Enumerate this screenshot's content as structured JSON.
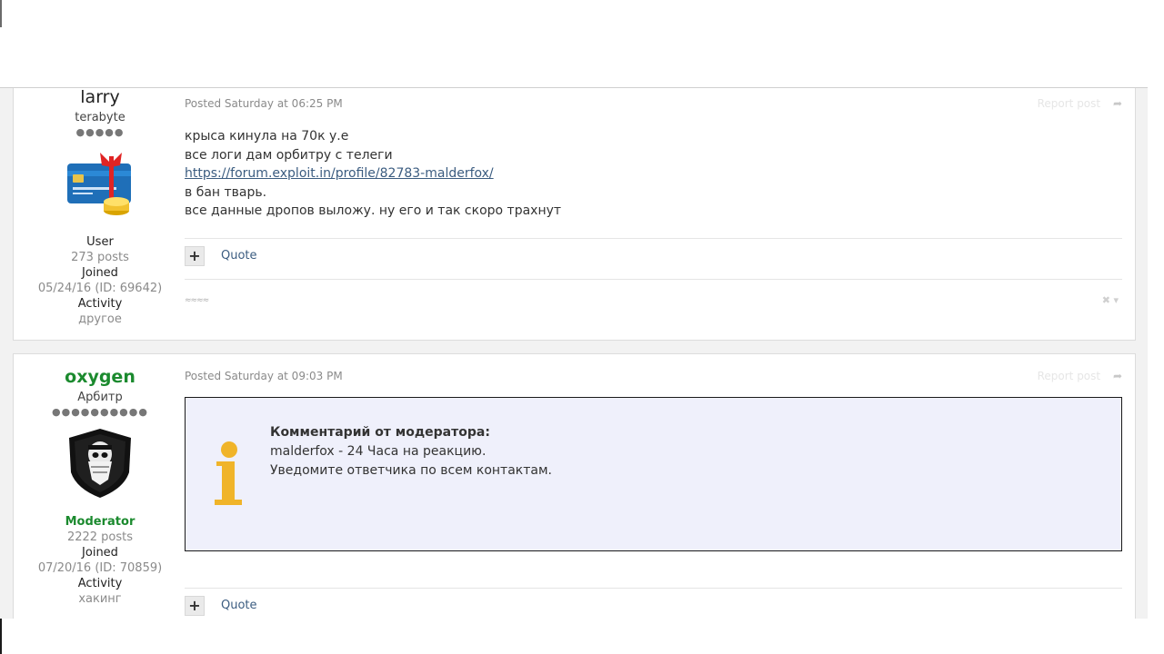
{
  "posts": [
    {
      "author": {
        "name": "larry",
        "title": "terabyte",
        "pips": "●●●●●",
        "role": "User",
        "posts": "273 posts",
        "joined_label": "Joined",
        "joined": "05/24/16 (ID: 69642)",
        "activity_label": "Activity",
        "activity": "другое"
      },
      "posted": "Posted Saturday at 06:25 PM",
      "report": "Report post",
      "lines": [
        "крыса кинула на 70к у.е",
        "все логи дам орбитру с телеги",
        "https://forum.exploit.in/profile/82783-malderfox/",
        "в бан тварь.",
        "все данные дропов выложу. ну его и так скоро трахнут"
      ],
      "actions": {
        "plus": "+",
        "quote": "Quote"
      },
      "signature": "≈≈≈≈",
      "signature_close": "✖ ▾"
    },
    {
      "author": {
        "name": "oxygen",
        "title": "Арбитр",
        "pips": "●●●●●●●●●●",
        "role": "Moderator",
        "posts": "2222 posts",
        "joined_label": "Joined",
        "joined": "07/20/16 (ID: 70859)",
        "activity_label": "Activity",
        "activity": "хакинг"
      },
      "posted": "Posted Saturday at 09:03 PM",
      "report": "Report post",
      "moderator_note": {
        "heading": "Комментарий от модератора:",
        "line1": "malderfox - 24 Часа на реакцию.",
        "line2": "Уведомите ответчика по всем контактам."
      },
      "actions": {
        "plus": "+",
        "quote": "Quote"
      }
    }
  ],
  "colors": {
    "moderator": "#1b8a2e",
    "link": "#3b5c80",
    "note_bg": "#eff0fb",
    "info_icon": "#f0b429"
  },
  "icons": [
    "share-icon",
    "info-icon",
    "credit-card-gift-avatar",
    "shield-skull-avatar",
    "close-icon"
  ]
}
